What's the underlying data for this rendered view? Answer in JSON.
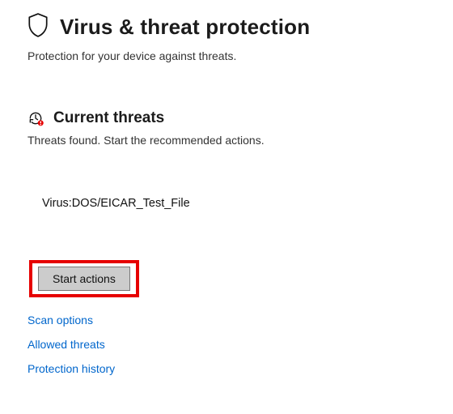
{
  "header": {
    "title": "Virus & threat protection",
    "subtitle": "Protection for your device against threats."
  },
  "currentThreats": {
    "title": "Current threats",
    "subtitle": "Threats found. Start the recommended actions.",
    "items": [
      "Virus:DOS/EICAR_Test_File"
    ]
  },
  "actions": {
    "start_label": "Start actions"
  },
  "links": {
    "scan_options": "Scan options",
    "allowed_threats": "Allowed threats",
    "protection_history": "Protection history"
  }
}
